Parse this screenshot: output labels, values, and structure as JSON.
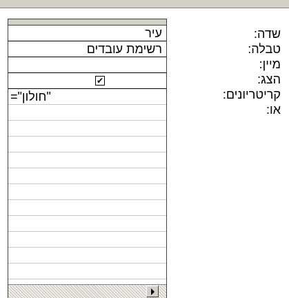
{
  "row_labels": {
    "field": "שדה:",
    "table": "טבלה:",
    "sort": "מיין:",
    "show": "הצג:",
    "criteria": "קריטריונים:",
    "or": "או:"
  },
  "column": {
    "field": "עיר",
    "table": "רשימת עובדים",
    "sort": "",
    "show_checked": true,
    "show_mark": "✔",
    "criteria": "=\"חולון\"",
    "or": ""
  }
}
